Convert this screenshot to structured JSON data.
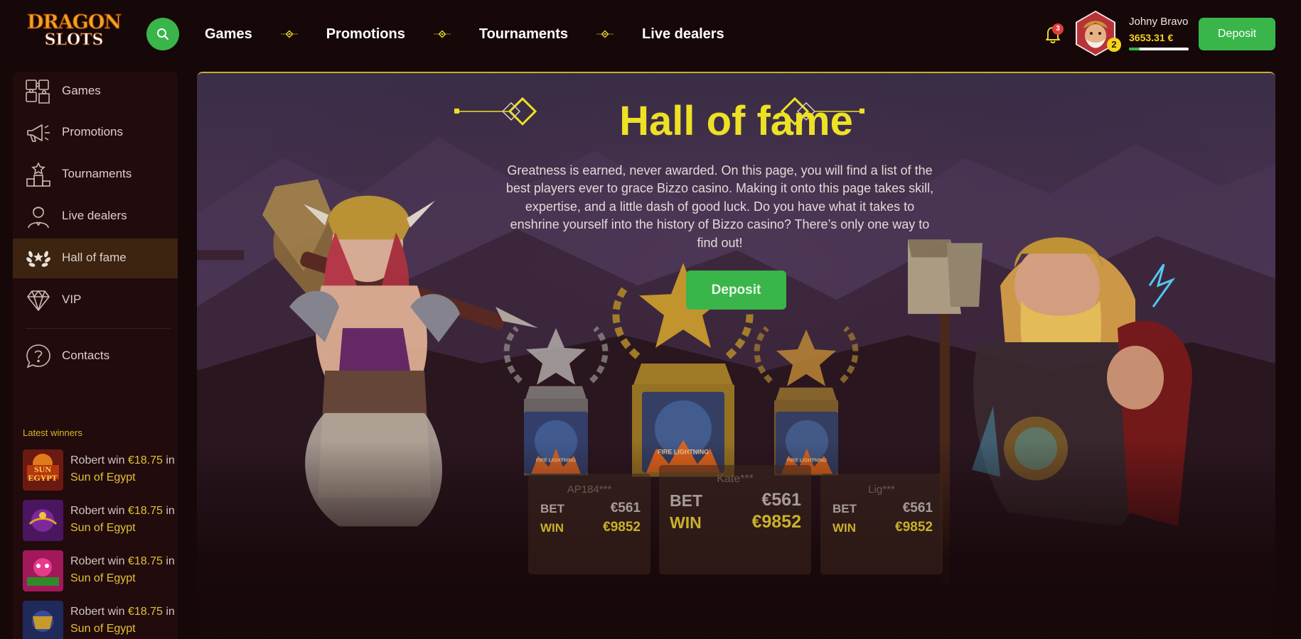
{
  "brand": {
    "logo_line1": "DRAGON",
    "logo_line2": "SLOTS"
  },
  "topnav": {
    "items": [
      "Games",
      "Promotions",
      "Tournaments",
      "Live dealers"
    ]
  },
  "notifications": {
    "count": "3"
  },
  "user": {
    "name": "Johny Bravo",
    "balance": "3653.31 €",
    "level": "2",
    "level_progress": 0.18
  },
  "header": {
    "deposit_label": "Deposit"
  },
  "sidebar": {
    "items": [
      {
        "label": "Games",
        "icon": "puzzle-icon"
      },
      {
        "label": "Promotions",
        "icon": "megaphone-icon"
      },
      {
        "label": "Tournaments",
        "icon": "podium-icon"
      },
      {
        "label": "Live dealers",
        "icon": "dealer-icon"
      },
      {
        "label": "Hall of fame",
        "icon": "laurel-wreath-icon"
      },
      {
        "label": "VIP",
        "icon": "diamond-icon"
      },
      {
        "label": "Contacts",
        "icon": "help-icon"
      }
    ],
    "latest_winners_title": "Latest winners",
    "winners": [
      {
        "name": "Robert",
        "action": "win",
        "amount": "€18.75",
        "prep": "in",
        "game": "Sun of Egypt"
      },
      {
        "name": "Robert",
        "action": "win",
        "amount": "€18.75",
        "prep": "in",
        "game": "Sun of Egypt"
      },
      {
        "name": "Robert",
        "action": "win",
        "amount": "€18.75",
        "prep": "in",
        "game": "Sun of Egypt"
      },
      {
        "name": "Robert",
        "action": "win",
        "amount": "€18.75",
        "prep": "in",
        "game": "Sun of Egypt"
      }
    ]
  },
  "hero": {
    "title": "Hall of fame",
    "description": "Greatness is earned, never awarded. On this page, you will find a list of the best players ever to grace Bizzo casino. Making it onto this page takes skill, expertise, and a little dash of good luck. Do you have what it takes to enshrine yourself into the history of Bizzo casino? There’s only one way to find out!",
    "deposit_label": "Deposit"
  },
  "podium": [
    {
      "place": "second",
      "name": "AP184***",
      "bet_label": "BET",
      "bet": "€561",
      "win_label": "WIN",
      "win": "€9852",
      "game_label": "FIRE LIGHTNING"
    },
    {
      "place": "first",
      "name": "Kate***",
      "bet_label": "BET",
      "bet": "€561",
      "win_label": "WIN",
      "win": "€9852",
      "game_label": "FIRE LIGHTNING"
    },
    {
      "place": "third",
      "name": "Lig***",
      "bet_label": "BET",
      "bet": "€561",
      "win_label": "WIN",
      "win": "€9852",
      "game_label": "FIRE LIGHTNING"
    }
  ],
  "colors": {
    "accent_green": "#39b54a",
    "accent_yellow": "#ede126",
    "gold": "#d4a42c",
    "background": "#160709"
  }
}
